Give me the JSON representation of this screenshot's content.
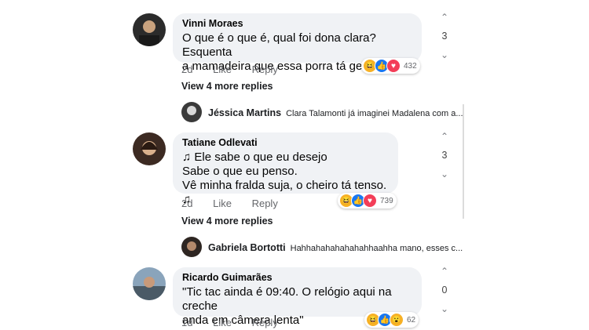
{
  "comments": [
    {
      "name": "Vinni Moraes",
      "line1": "O que é o que é,  qual foi dona clara? Esquenta",
      "line2": "a mamadeira que essa porra tá gelada kkkk",
      "line3": "",
      "time": "2d",
      "like": "Like",
      "reply": "Reply",
      "reaction_count": "432",
      "votes": "3",
      "view_more": "View 4 more replies",
      "reply_preview": {
        "name": "Jéssica Martins",
        "text": "Clara Talamonti já imaginei Madalena com a..."
      }
    },
    {
      "name": "Tatiane Odlevati",
      "line1": "♫ Ele sabe o que eu desejo",
      "line2": "Sabe o que eu penso.",
      "line3": "Vê minha fralda suja, o cheiro tá tenso. ♫",
      "time": "2d",
      "like": "Like",
      "reply": "Reply",
      "reaction_count": "739",
      "votes": "3",
      "view_more": "View 4 more replies",
      "reply_preview": {
        "name": "Gabriela Bortotti",
        "text": "Hahhahahahahahahhaahha mano, esses c..."
      }
    },
    {
      "name": "Ricardo Guimarães",
      "line1": "\"Tic tac ainda é 09:40. O relógio aqui na creche",
      "line2": "anda em câmera lenta\"",
      "line3": "",
      "time": "1d",
      "like": "Like",
      "reply": "Reply",
      "reaction_count": "62",
      "votes": "0"
    }
  ],
  "icons": {
    "up": "⌃",
    "down": "⌄"
  },
  "colors": {
    "bubble": "#f0f2f5",
    "like_blue": "#1877f2",
    "love_red": "#f33e58",
    "haha_yellow": "#f7b125"
  }
}
